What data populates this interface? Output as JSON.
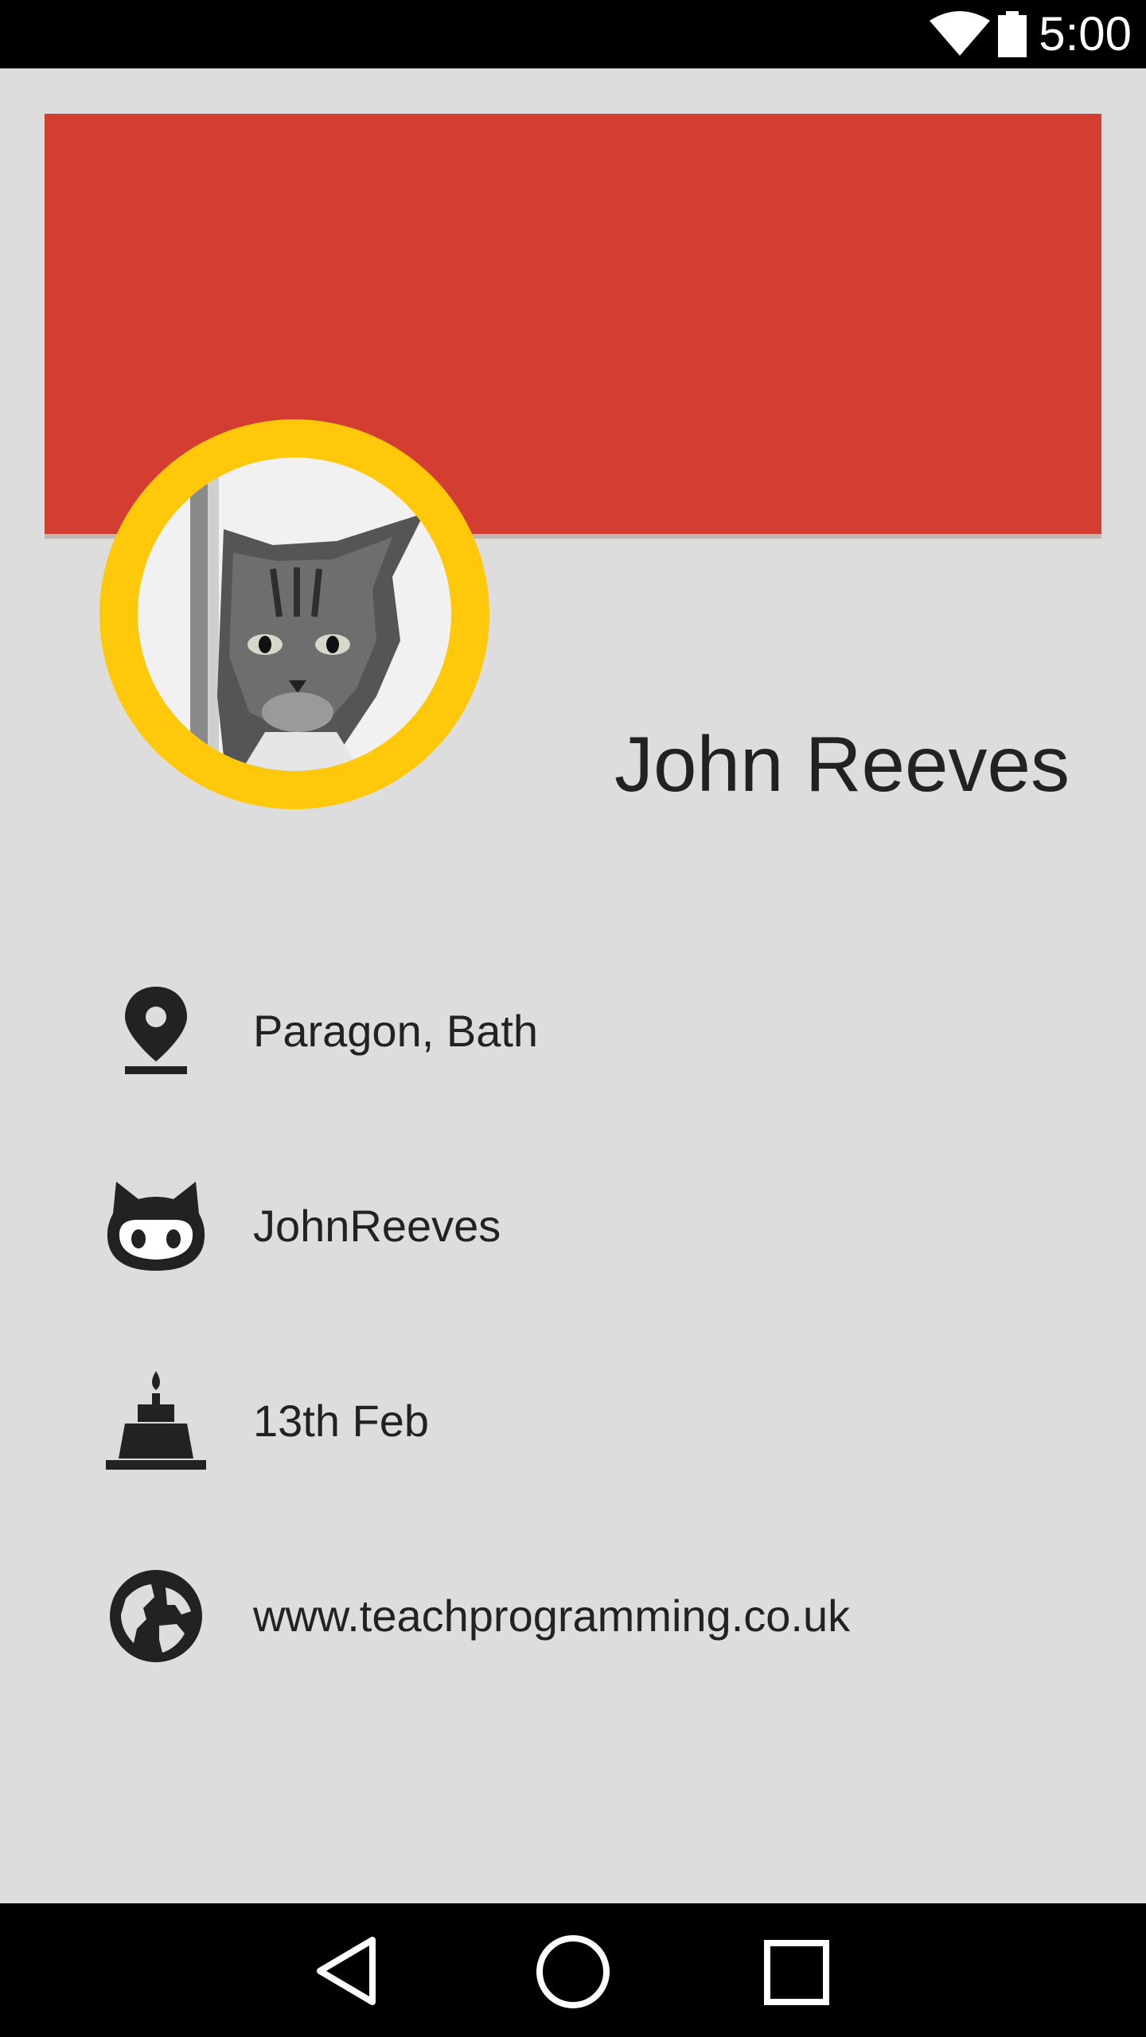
{
  "status_bar": {
    "time": "5:00",
    "icons": [
      "wifi-icon",
      "battery-icon"
    ]
  },
  "colors": {
    "banner": "#d43d31",
    "avatar_ring": "#ffc80a",
    "background": "#dddddd"
  },
  "profile": {
    "name": "John Reeves",
    "avatar_icon": "cat-photo"
  },
  "details": [
    {
      "icon": "location-pin-icon",
      "text": "Paragon, Bath"
    },
    {
      "icon": "github-octocat-icon",
      "text": "JohnReeves"
    },
    {
      "icon": "birthday-cake-icon",
      "text": "13th Feb"
    },
    {
      "icon": "globe-icon",
      "text": "www.teachprogramming.co.uk"
    }
  ],
  "nav_bar": {
    "buttons": [
      "back-icon",
      "home-icon",
      "recents-icon"
    ]
  }
}
